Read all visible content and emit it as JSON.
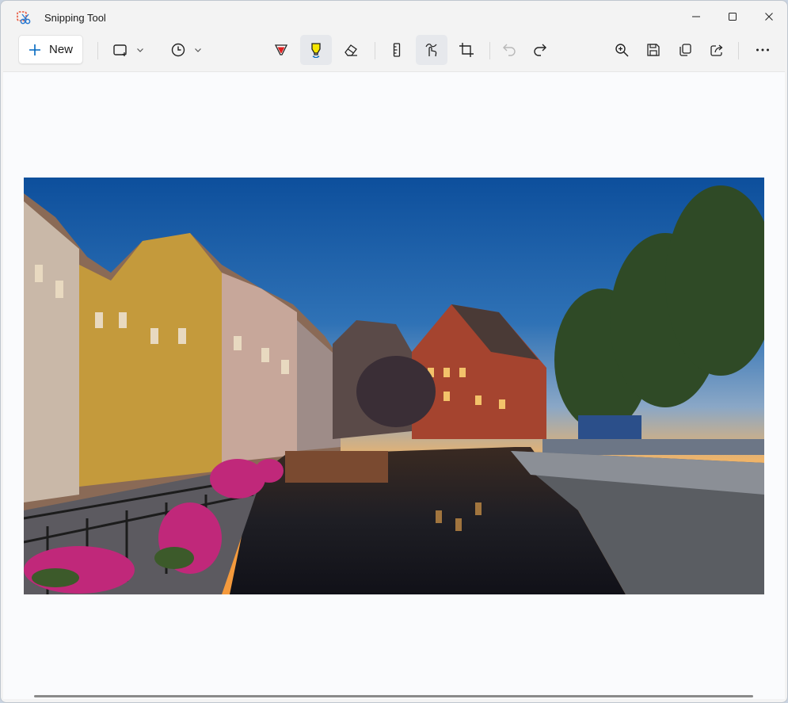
{
  "app": {
    "title": "Snipping Tool",
    "icon": "snipping-tool-icon"
  },
  "window_controls": {
    "minimize": "minimize-icon",
    "maximize": "maximize-icon",
    "close": "close-icon"
  },
  "toolbar": {
    "new_label": "New",
    "tools": [
      {
        "name": "snip-mode",
        "icon": "rectangle-snip-icon",
        "dropdown": true
      },
      {
        "name": "delay",
        "icon": "clock-icon",
        "dropdown": true
      },
      {
        "name": "ballpoint-pen",
        "icon": "pen-icon",
        "color": "#e02020"
      },
      {
        "name": "highlighter",
        "icon": "highlighter-icon",
        "color": "#f5e600",
        "active": true
      },
      {
        "name": "eraser",
        "icon": "eraser-icon"
      },
      {
        "name": "ruler",
        "icon": "ruler-icon"
      },
      {
        "name": "touch-writing",
        "icon": "touch-write-icon",
        "active": true
      },
      {
        "name": "crop",
        "icon": "crop-icon"
      },
      {
        "name": "undo",
        "icon": "undo-icon",
        "disabled": true
      },
      {
        "name": "redo",
        "icon": "redo-icon"
      },
      {
        "name": "zoom",
        "icon": "zoom-in-icon"
      },
      {
        "name": "save",
        "icon": "save-icon"
      },
      {
        "name": "copy",
        "icon": "copy-icon"
      },
      {
        "name": "share",
        "icon": "share-icon"
      },
      {
        "name": "more",
        "icon": "more-icon"
      }
    ]
  },
  "canvas": {
    "image": "colmar-little-venice-canal-at-dusk"
  },
  "colors": {
    "accent": "#0067c0",
    "window_bg": "#f3f3f3",
    "canvas_bg": "#fafbfd"
  }
}
